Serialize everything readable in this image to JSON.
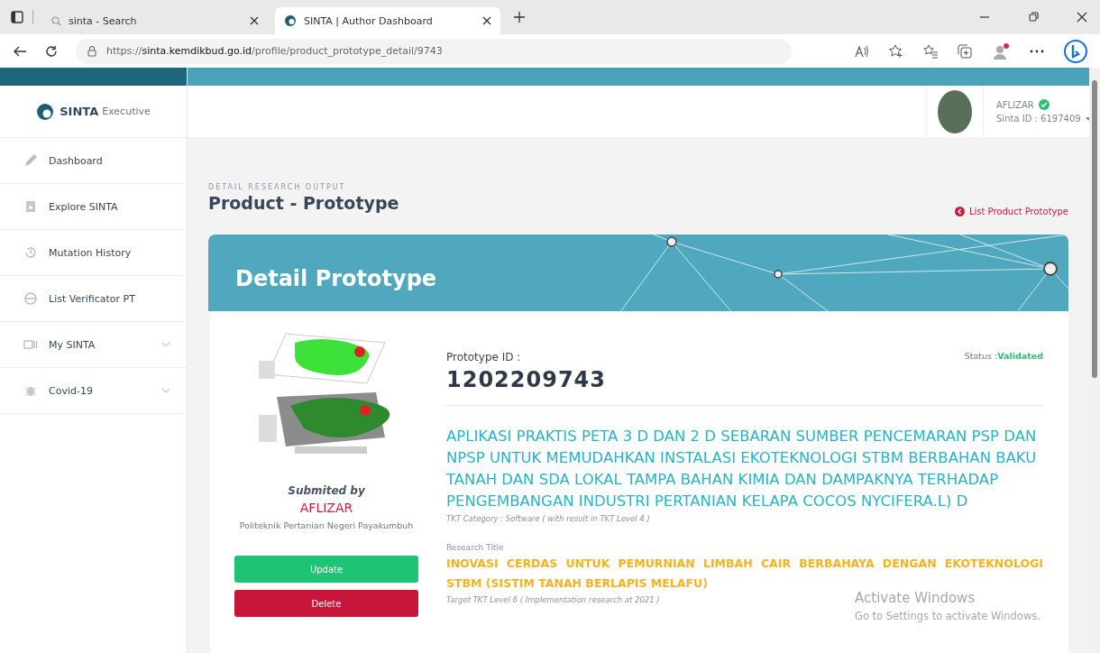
{
  "browser": {
    "tabs": [
      {
        "title": "sinta - Search",
        "selected": false
      },
      {
        "title": "SINTA | Author Dashboard",
        "selected": true
      }
    ],
    "url_prefix": "https://",
    "url_host": "sinta.kemdikbud.go.id",
    "url_path": "/profile/product_prototype_detail/9743",
    "profile_notification": true
  },
  "sidebar": {
    "brand": "SINTA",
    "brand_suffix": "Executive",
    "items": [
      {
        "label": "Dashboard",
        "kind": "link"
      },
      {
        "label": "Explore SINTA",
        "kind": "link"
      },
      {
        "label": "Mutation History",
        "kind": "link"
      },
      {
        "label": "List Verificator PT",
        "kind": "link"
      },
      {
        "label": "My SINTA",
        "kind": "group"
      },
      {
        "label": "Covid-19",
        "kind": "group"
      }
    ]
  },
  "header": {
    "user_name": "AFLIZAR",
    "verified": true,
    "sinta_id": "Sinta ID : 6197409"
  },
  "page": {
    "overline": "DETAIL RESEARCH OUTPUT",
    "title": "Product - Prototype",
    "back_link": "List Product Prototype"
  },
  "detail": {
    "banner_title": "Detail Prototype",
    "submitted_label": "Submited by",
    "author": "AFLIZAR",
    "institution": "Politeknik Pertanian Negeri Payakumbuh",
    "buttons": [
      {
        "label": "Update",
        "kind": "update"
      },
      {
        "label": "Delete",
        "kind": "delete"
      }
    ],
    "id_label": "Prototype ID :",
    "id": "1202209743",
    "status_label": "Status :",
    "status": "Validated",
    "title": "APLIKASI PRAKTIS PETA 3 D DAN 2 D SEBARAN SUMBER PENCEMARAN PSP DAN NPSP UNTUK MEMUDAHKAN INSTALASI EKOTEKNOLOGI STBM BERBAHAN BAKU TANAH DAN SDA LOKAL TAMPA BAHAN KIMIA DAN DAMPAKNYA TERHADAP PENGEMBANGAN INDUSTRI PERTANIAN KELAPA COCOS NYCIFERA.L) D",
    "category": "TKT Category : Software ( with result in TKT Level  4 )",
    "research_label": "Research Title",
    "research_title": "INOVASI CERDAS UNTUK PEMURNIAN LIMBAH CAIR BERBAHAYA DENGAN EKOTEKNOLOGI STBM (SISTIM TANAH BERLAPIS MELAFU)",
    "target": "Target TKT Level 6 ( Implementation research at  2021 )"
  },
  "os_overlay": {
    "title": "Activate Windows",
    "hint": "Go to Settings to activate Windows."
  }
}
